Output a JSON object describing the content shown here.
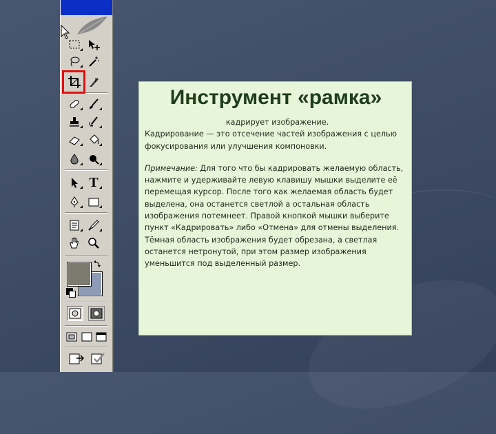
{
  "panel": {
    "title": "Инструмент «рамка»",
    "intro": "кадрирует изображение.",
    "term": "Кадрирование",
    "definition": " — это отсечение частей изображения с целью фокусирования или улучшения компоновки.",
    "note_label": "Примечание:",
    "note_text": " Для того что бы кадрировать желаемую область, нажмите и удерживайте левую клавишу мышки выделите её перемещая курсор. После того как желаемая область будет выделена, она останется светлой а остальная область изображения потемнеет. Правой кнопкой мышки выберите пункт «Кадрировать» либо «Отмена» для отмены выделения. Тёмная область изображения будет обрезана, а светлая останется нетронутой, при этом размер изображения уменьшится под выделенный размер."
  },
  "toolbox": {
    "tools": [
      "marquee-icon",
      "move-icon",
      "lasso-icon",
      "magic-wand-icon",
      "crop-icon",
      "slice-icon",
      "healing-brush-icon",
      "brush-icon",
      "clone-stamp-icon",
      "history-brush-icon",
      "eraser-icon",
      "paint-bucket-icon",
      "blur-icon",
      "dodge-icon",
      "path-selection-icon",
      "type-icon",
      "pen-icon",
      "rectangle-shape-icon",
      "notes-icon",
      "eyedropper-icon",
      "hand-icon",
      "zoom-icon"
    ],
    "type_tool_glyph": "T",
    "highlighted_tool": "crop-icon",
    "foreground_color": "#7d7a6f",
    "background_color": "#8e9bb6"
  }
}
